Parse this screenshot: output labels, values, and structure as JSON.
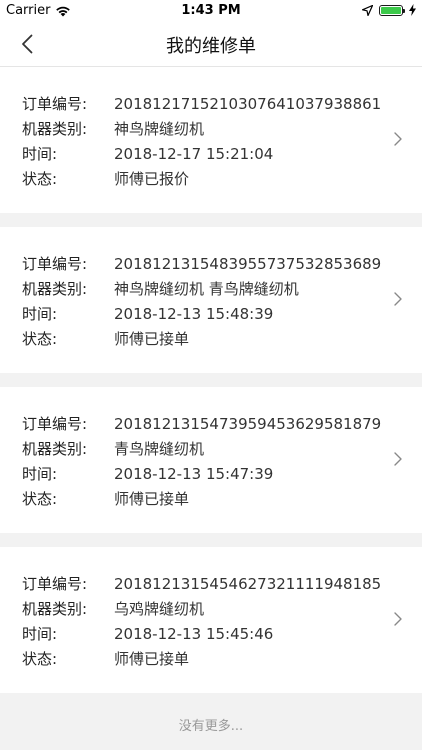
{
  "status": {
    "carrier": "Carrier",
    "time": "1:43 PM"
  },
  "nav": {
    "title": "我的维修单"
  },
  "labels": {
    "order_no": "订单编号:",
    "machine_type": "机器类别:",
    "time": "时间:",
    "status": "状态:"
  },
  "orders": [
    {
      "order_no": "20181217152103076410379388 61",
      "machine": "神鸟牌缝纫机",
      "time": "2018-12-17 15:21:04",
      "status": "师傅已报价"
    },
    {
      "order_no": "20181213154839557375328536 89",
      "machine": "神鸟牌缝纫机 青鸟牌缝纫机",
      "time": "2018-12-13 15:48:39",
      "status": "师傅已接单"
    },
    {
      "order_no": "20181213154739594536295818 79",
      "machine": "青鸟牌缝纫机",
      "time": "2018-12-13 15:47:39",
      "status": "师傅已接单"
    },
    {
      "order_no": "20181213154546273211119481 85",
      "machine": "乌鸡牌缝纫机",
      "time": "2018-12-13 15:45:46",
      "status": "师傅已接单"
    }
  ],
  "footer": {
    "text": "没有更多..."
  }
}
